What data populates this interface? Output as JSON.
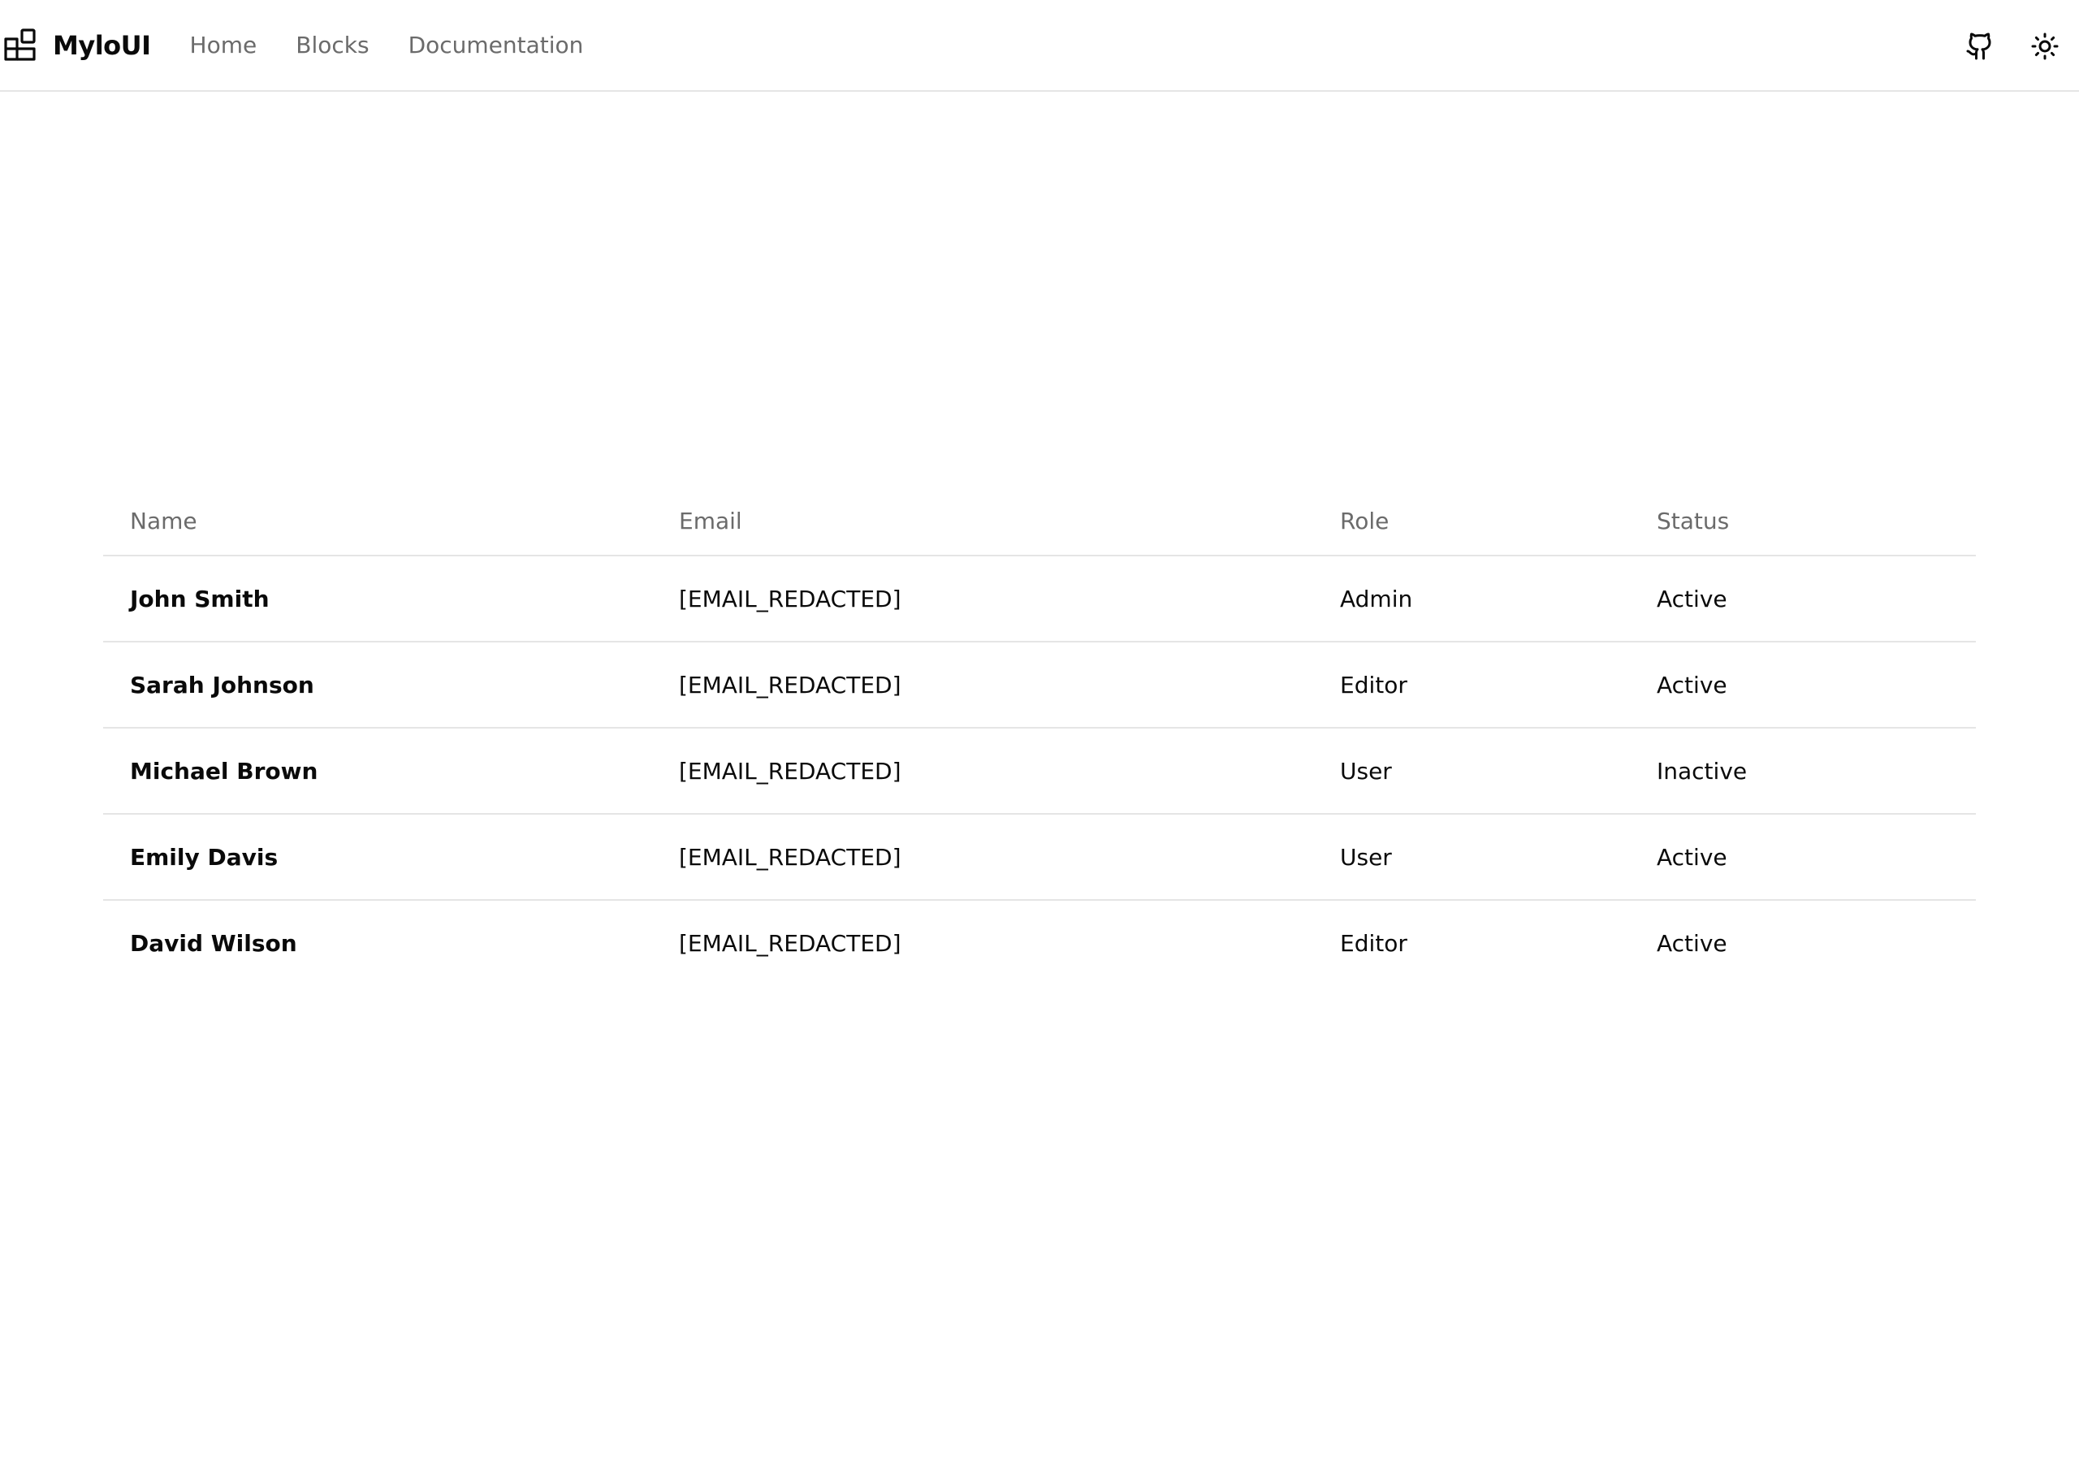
{
  "header": {
    "brand": "MyloUI",
    "nav": [
      "Home",
      "Blocks",
      "Documentation"
    ],
    "actions": {
      "github_icon": "github-icon",
      "theme_icon": "sun-icon"
    }
  },
  "table": {
    "columns": [
      "Name",
      "Email",
      "Role",
      "Status"
    ],
    "rows": [
      {
        "name": "John Smith",
        "email": "[EMAIL_REDACTED]",
        "role": "Admin",
        "status": "Active"
      },
      {
        "name": "Sarah Johnson",
        "email": "[EMAIL_REDACTED]",
        "role": "Editor",
        "status": "Active"
      },
      {
        "name": "Michael Brown",
        "email": "[EMAIL_REDACTED]",
        "role": "User",
        "status": "Inactive"
      },
      {
        "name": "Emily Davis",
        "email": "[EMAIL_REDACTED]",
        "role": "User",
        "status": "Active"
      },
      {
        "name": "David Wilson",
        "email": "[EMAIL_REDACTED]",
        "role": "Editor",
        "status": "Active"
      }
    ]
  },
  "colors": {
    "text": "#0a0a0a",
    "muted": "#6b6b6b",
    "border": "#e5e5e5",
    "background": "#ffffff"
  }
}
